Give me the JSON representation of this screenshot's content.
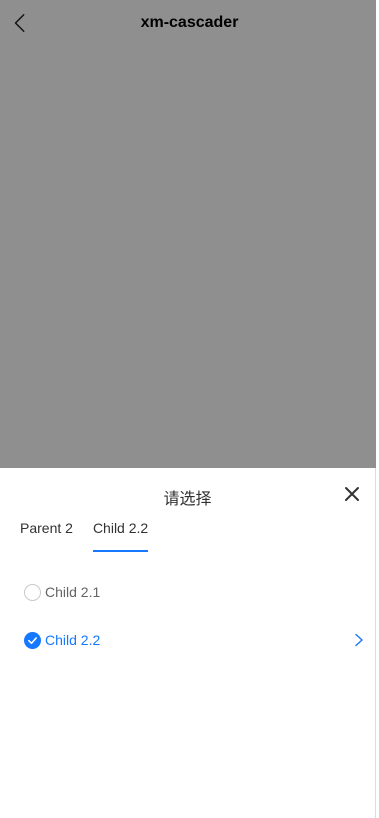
{
  "navbar": {
    "title": "xm-cascader",
    "back_icon": "chevron-left-icon"
  },
  "sheet": {
    "title": "请选择",
    "close_icon": "close-icon",
    "tabs": [
      {
        "label": "Parent 2",
        "active": false
      },
      {
        "label": "Child 2.2",
        "active": true
      }
    ],
    "options": [
      {
        "label": "Child 2.1",
        "selected": false,
        "has_children": false
      },
      {
        "label": "Child 2.2",
        "selected": true,
        "has_children": true
      }
    ],
    "accent_color": "#1677ff"
  }
}
